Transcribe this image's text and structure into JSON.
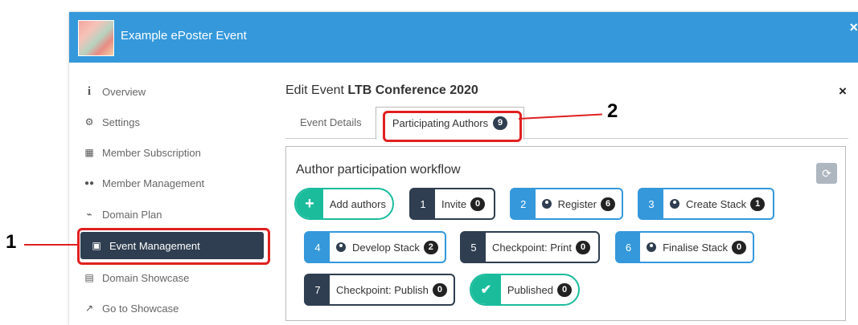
{
  "app": {
    "title": "Example ePoster Event",
    "close": "×"
  },
  "sidebar": {
    "items": [
      {
        "icon": "info-icon",
        "glyph": "i",
        "label": "Overview"
      },
      {
        "icon": "gear-icon",
        "glyph": "⚙",
        "label": "Settings"
      },
      {
        "icon": "qrcode-icon",
        "glyph": "▦",
        "label": "Member Subscription"
      },
      {
        "icon": "users-icon",
        "glyph": "👥",
        "label": "Member Management"
      },
      {
        "icon": "paperclip-icon",
        "glyph": "⌁",
        "label": "Domain Plan"
      },
      {
        "icon": "calendar-icon",
        "glyph": "▣",
        "label": "Event Management"
      },
      {
        "icon": "newspaper-icon",
        "glyph": "▤",
        "label": "Domain Showcase"
      },
      {
        "icon": "external-link-icon",
        "glyph": "↗",
        "label": "Go to Showcase"
      }
    ]
  },
  "annotations": {
    "one": "1",
    "two": "2"
  },
  "content": {
    "title_prefix": "Edit Event",
    "event_name": "LTB Conference 2020",
    "close": "×",
    "tabs": [
      {
        "label": "Event Details"
      },
      {
        "label": "Participating Authors",
        "count": "9"
      }
    ]
  },
  "workflow": {
    "title": "Author participation workflow",
    "refresh_icon": "refresh-icon",
    "steps": [
      {
        "num": "+",
        "label": "Add authors",
        "count": ""
      },
      {
        "num": "1",
        "label": "Invite",
        "count": "0"
      },
      {
        "num": "2",
        "label": "Register",
        "count": "6"
      },
      {
        "num": "3",
        "label": "Create Stack",
        "count": "1"
      },
      {
        "num": "4",
        "label": "Develop Stack",
        "count": "2"
      },
      {
        "num": "5",
        "label": "Checkpoint: Print",
        "count": "0"
      },
      {
        "num": "6",
        "label": "Finalise Stack",
        "count": "0"
      },
      {
        "num": "7",
        "label": "Checkpoint: Publish",
        "count": "0"
      },
      {
        "num": "✔",
        "label": "Published",
        "count": "0"
      }
    ]
  },
  "colors": {
    "topbar": "#3498db",
    "dark": "#2f3e50",
    "green": "#1abc9c",
    "annotation": "#e02020"
  }
}
